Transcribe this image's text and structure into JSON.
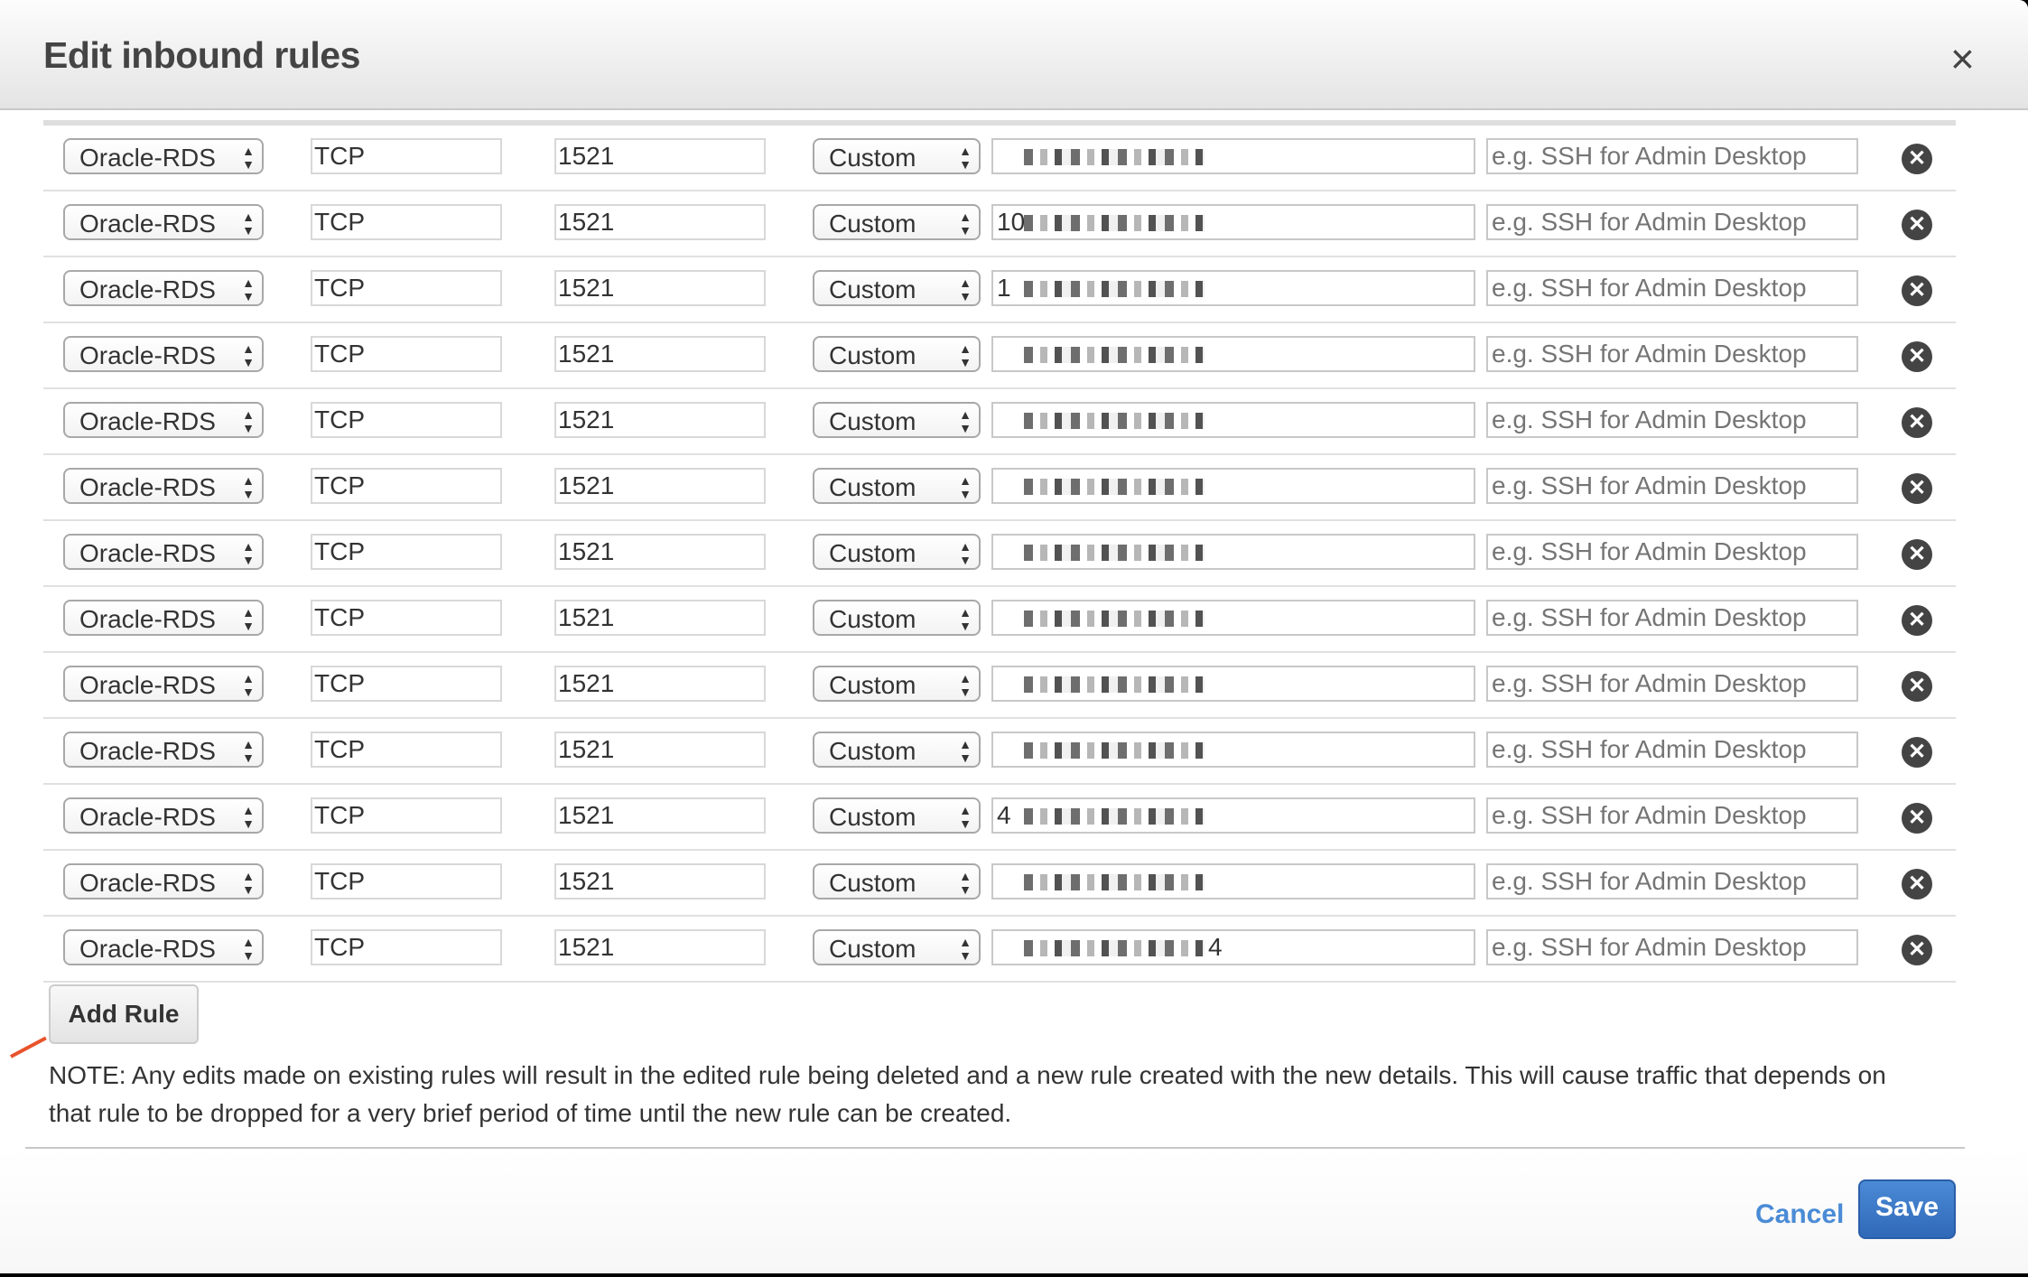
{
  "dialog": {
    "title": "Edit inbound rules",
    "close_icon": "close-icon"
  },
  "rules": [
    {
      "type": "Oracle-RDS",
      "protocol": "TCP",
      "port": "1521",
      "source_mode": "Custom",
      "source_prefix": "",
      "source_suffix": "",
      "description_placeholder": "e.g. SSH for Admin Desktop"
    },
    {
      "type": "Oracle-RDS",
      "protocol": "TCP",
      "port": "1521",
      "source_mode": "Custom",
      "source_prefix": "10",
      "source_suffix": "",
      "description_placeholder": "e.g. SSH for Admin Desktop"
    },
    {
      "type": "Oracle-RDS",
      "protocol": "TCP",
      "port": "1521",
      "source_mode": "Custom",
      "source_prefix": "1",
      "source_suffix": "",
      "description_placeholder": "e.g. SSH for Admin Desktop"
    },
    {
      "type": "Oracle-RDS",
      "protocol": "TCP",
      "port": "1521",
      "source_mode": "Custom",
      "source_prefix": "",
      "source_suffix": "",
      "description_placeholder": "e.g. SSH for Admin Desktop"
    },
    {
      "type": "Oracle-RDS",
      "protocol": "TCP",
      "port": "1521",
      "source_mode": "Custom",
      "source_prefix": "",
      "source_suffix": "",
      "description_placeholder": "e.g. SSH for Admin Desktop"
    },
    {
      "type": "Oracle-RDS",
      "protocol": "TCP",
      "port": "1521",
      "source_mode": "Custom",
      "source_prefix": "",
      "source_suffix": "",
      "description_placeholder": "e.g. SSH for Admin Desktop"
    },
    {
      "type": "Oracle-RDS",
      "protocol": "TCP",
      "port": "1521",
      "source_mode": "Custom",
      "source_prefix": "",
      "source_suffix": "",
      "description_placeholder": "e.g. SSH for Admin Desktop"
    },
    {
      "type": "Oracle-RDS",
      "protocol": "TCP",
      "port": "1521",
      "source_mode": "Custom",
      "source_prefix": "",
      "source_suffix": "",
      "description_placeholder": "e.g. SSH for Admin Desktop"
    },
    {
      "type": "Oracle-RDS",
      "protocol": "TCP",
      "port": "1521",
      "source_mode": "Custom",
      "source_prefix": "",
      "source_suffix": "",
      "description_placeholder": "e.g. SSH for Admin Desktop"
    },
    {
      "type": "Oracle-RDS",
      "protocol": "TCP",
      "port": "1521",
      "source_mode": "Custom",
      "source_prefix": "",
      "source_suffix": "",
      "description_placeholder": "e.g. SSH for Admin Desktop"
    },
    {
      "type": "Oracle-RDS",
      "protocol": "TCP",
      "port": "1521",
      "source_mode": "Custom",
      "source_prefix": "4",
      "source_suffix": "",
      "description_placeholder": "e.g. SSH for Admin Desktop"
    },
    {
      "type": "Oracle-RDS",
      "protocol": "TCP",
      "port": "1521",
      "source_mode": "Custom",
      "source_prefix": "",
      "source_suffix": "",
      "description_placeholder": "e.g. SSH for Admin Desktop"
    },
    {
      "type": "Oracle-RDS",
      "protocol": "TCP",
      "port": "1521",
      "source_mode": "Custom",
      "source_prefix": "",
      "source_suffix": "4",
      "description_placeholder": "e.g. SSH for Admin Desktop"
    }
  ],
  "actions": {
    "add_rule": "Add Rule",
    "cancel": "Cancel",
    "save": "Save"
  },
  "note": "NOTE: Any edits made on existing rules will result in the edited rule being deleted and a new rule created with the new details. This will cause traffic that depends on that rule to be dropped for a very brief period of time until the new rule can be created.",
  "icons": {
    "close": "×",
    "remove": "✕",
    "select_arrows": "▲▼"
  },
  "colors": {
    "primary_button": "#3a78c9",
    "link": "#4a8bd6",
    "annotation_arrow": "#e8532b"
  }
}
